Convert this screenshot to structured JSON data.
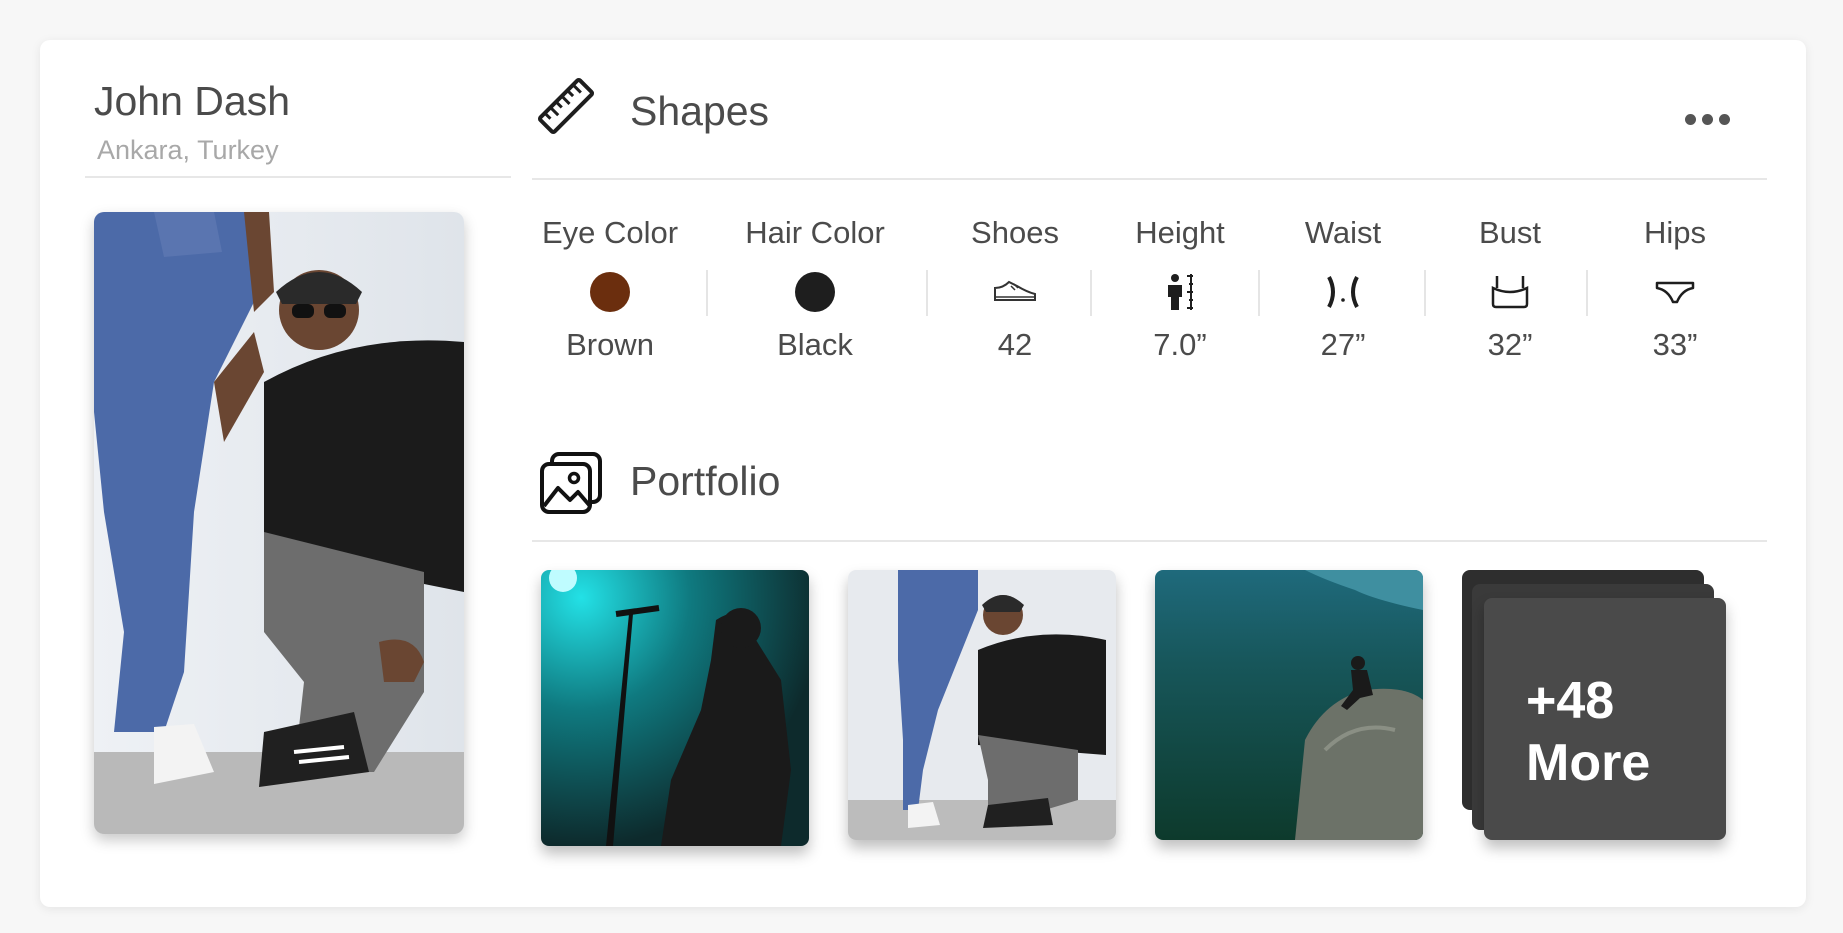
{
  "profile": {
    "name": "John Dash",
    "location": "Ankara, Turkey",
    "photo_icon": "profile-photo"
  },
  "shapes": {
    "title": "Shapes",
    "icon": "ruler-icon",
    "more_icon": "ellipsis-icon",
    "stats": [
      {
        "label": "Eye Color",
        "value": "Brown",
        "icon": "color-swatch",
        "color": "#6b2e0e"
      },
      {
        "label": "Hair Color",
        "value": "Black",
        "icon": "color-swatch",
        "color": "#1e1e1e"
      },
      {
        "label": "Shoes",
        "value": "42",
        "icon": "shoe-icon"
      },
      {
        "label": "Height",
        "value": "7.0”",
        "icon": "height-icon"
      },
      {
        "label": "Waist",
        "value": "27”",
        "icon": "waist-icon"
      },
      {
        "label": "Bust",
        "value": "32”",
        "icon": "bust-icon"
      },
      {
        "label": "Hips",
        "value": "33”",
        "icon": "hips-icon"
      }
    ]
  },
  "portfolio": {
    "title": "Portfolio",
    "icon": "gallery-icon",
    "photos": [
      "concert-photo",
      "street-photo",
      "mountain-photo"
    ],
    "more_count": "+48",
    "more_label": "More"
  },
  "colors": {
    "text": "#4b4b4b",
    "muted": "#a8a8a8",
    "divider": "#e7e7e7",
    "more_tile": "#4a4a4a"
  }
}
